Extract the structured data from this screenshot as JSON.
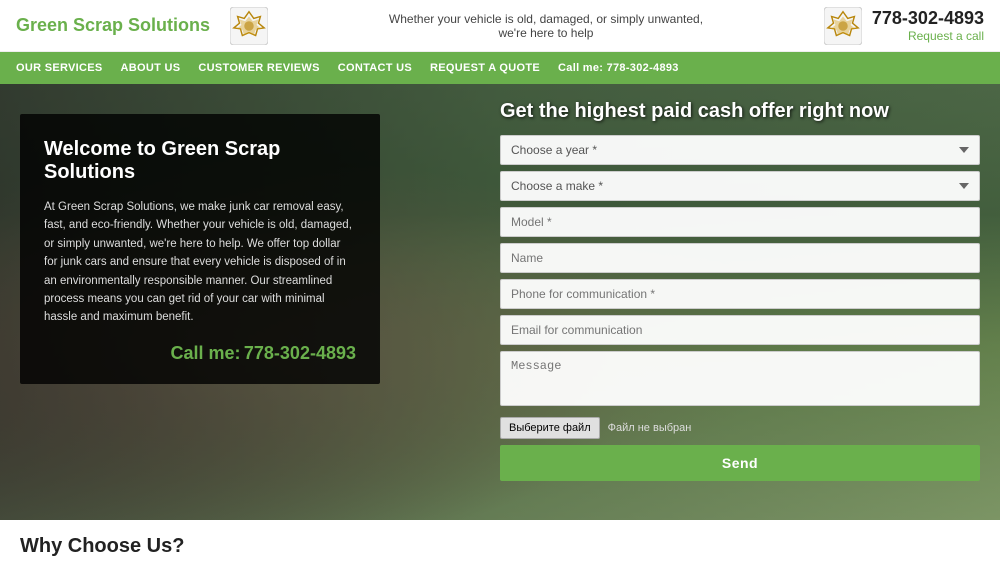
{
  "header": {
    "logo": "Green Scrap Solutions",
    "tagline_line1": "Whether your vehicle is old, damaged, or simply unwanted,",
    "tagline_line2": "we're here to help",
    "phone": "778-302-4893",
    "request_call": "Request a call"
  },
  "nav": {
    "items": [
      {
        "label": "OUR SERVICES",
        "id": "our-services"
      },
      {
        "label": "ABOUT US",
        "id": "about-us"
      },
      {
        "label": "CUSTOMER REVIEWS",
        "id": "customer-reviews"
      },
      {
        "label": "CONTACT US",
        "id": "contact-us"
      },
      {
        "label": "REQUEST A QUOTE",
        "id": "request-quote"
      },
      {
        "label": "Call me: 778-302-4893",
        "id": "call-me"
      }
    ]
  },
  "hero": {
    "form_title": "Get the highest paid cash offer right now",
    "year_placeholder": "Choose a year *",
    "make_placeholder": "Choose a make *",
    "model_placeholder": "Model *",
    "name_placeholder": "Name",
    "phone_placeholder": "Phone for communication *",
    "email_placeholder": "Email for communication",
    "message_placeholder": "Message",
    "file_button": "Выберите файл",
    "file_label": "Файл не выбран",
    "send_button": "Send",
    "welcome_title": "Welcome to Green Scrap Solutions",
    "welcome_body": "At Green Scrap Solutions, we make junk car removal easy, fast, and eco-friendly. Whether your vehicle is old, damaged, or simply unwanted, we're here to help. We offer top dollar for junk cars and ensure that every vehicle is disposed of in an environmentally responsible manner. Our streamlined process means you can get rid of your car with minimal hassle and maximum benefit.",
    "call_label": "Call me:",
    "call_phone": "778-302-4893"
  },
  "why_section": {
    "title": "Why Choose Us?"
  }
}
